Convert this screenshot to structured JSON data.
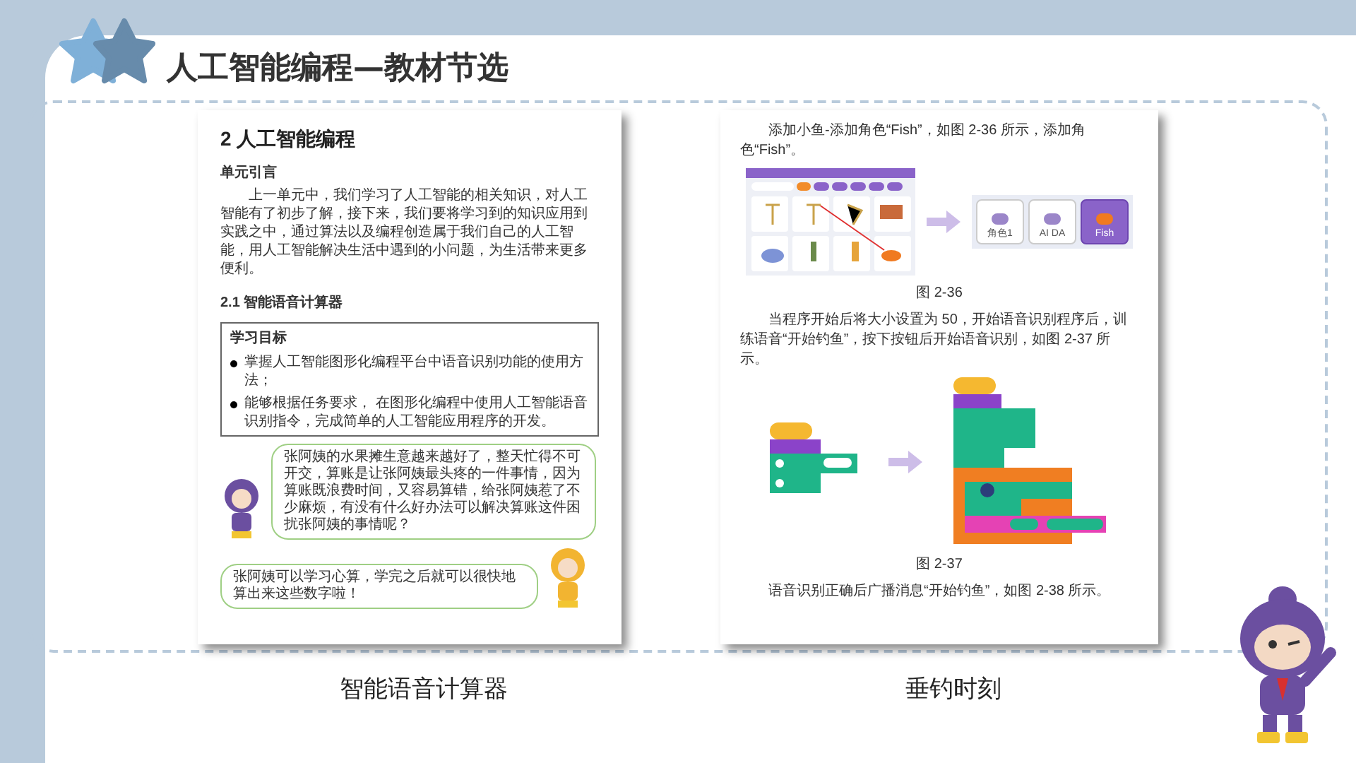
{
  "header": {
    "title": "人工智能编程—教材节选"
  },
  "left_page": {
    "chapter_title": "2 人工智能编程",
    "section_label": "单元引言",
    "intro": "上一单元中，我们学习了人工智能的相关知识，对人工智能有了初步了解，接下来，我们要将学习到的知识应用到实践之中，通过算法以及编程创造属于我们自己的人工智能，用人工智能解决生活中遇到的小问题，为生活带来更多便利。",
    "subsection": "2.1 智能语音计算器",
    "goals": {
      "title": "学习目标",
      "items": [
        "掌握人工智能图形化编程平台中语音识别功能的使用方法；",
        "能够根据任务要求， 在图形化编程中使用人工智能语音识别指令，完成简单的人工智能应用程序的开发。"
      ]
    },
    "dialogues": [
      {
        "kind": "question",
        "color": "#6b4fa0",
        "text": "张阿姨的水果摊生意越来越好了，整天忙得不可开交，算账是让张阿姨最头疼的一件事情，因为算账既浪费时间，又容易算错，给张阿姨惹了不少麻烦，有没有什么好办法可以解决算账这件困扰张阿姨的事情呢？"
      },
      {
        "kind": "answer",
        "color": "#f2b431",
        "text": "张阿姨可以学习心算，学完之后就可以很快地算出来这些数字啦！"
      }
    ]
  },
  "right_page": {
    "blocks": [
      {
        "kind": "paragraph",
        "text": "添加小鱼-添加角色“Fish”，如图 2-36 所示，添加角色“Fish”。"
      },
      {
        "kind": "sprite_figure",
        "sprites": [
          {
            "label": "角色1",
            "selected": false
          },
          {
            "label": "AI DA",
            "selected": false
          },
          {
            "label": "Fish",
            "selected": true
          }
        ]
      },
      {
        "kind": "caption",
        "text": "图 2-36"
      },
      {
        "kind": "paragraph",
        "text": "当程序开始后将大小设置为 50，开始语音识别程序后，训练语音“开始钓鱼”，按下按钮后开始语音识别，如图 2-37 所示。"
      },
      {
        "kind": "code_figure"
      },
      {
        "kind": "caption",
        "text": "图 2-37"
      },
      {
        "kind": "paragraph",
        "text": "语音识别正确后广播消息“开始钓鱼”，如图 2-38 所示。"
      }
    ]
  },
  "captions": [
    "智能语音计算器",
    "垂钓时刻"
  ]
}
